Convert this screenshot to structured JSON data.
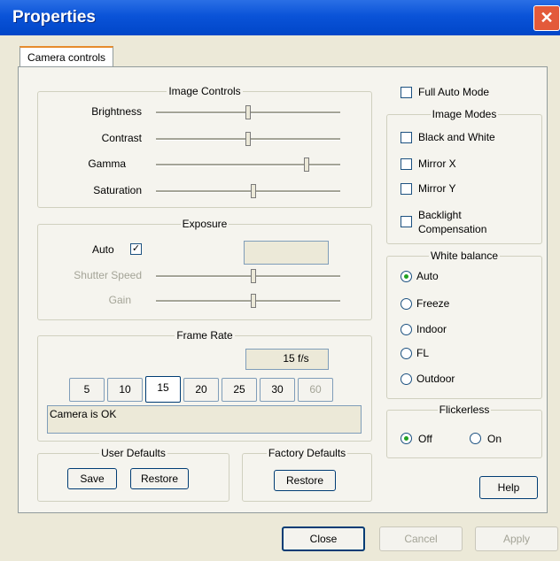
{
  "window": {
    "title": "Properties"
  },
  "tabs": [
    {
      "label": "Camera controls"
    }
  ],
  "image_controls": {
    "legend": "Image Controls",
    "sliders": [
      {
        "label": "Brightness",
        "value": 0.5
      },
      {
        "label": "Contrast",
        "value": 0.5
      },
      {
        "label": "Gamma",
        "value": 0.82
      },
      {
        "label": "Saturation",
        "value": 0.52
      }
    ]
  },
  "exposure": {
    "legend": "Exposure",
    "auto_label": "Auto",
    "auto_checked": true,
    "shutter_label": "Shutter Speed",
    "shutter_value": 0.5,
    "gain_label": "Gain",
    "gain_value": 0.5
  },
  "frame_rate": {
    "legend": "Frame Rate",
    "display": "15 f/s",
    "rates": [
      "5",
      "10",
      "15",
      "20",
      "25",
      "30",
      "60"
    ],
    "selected": "15",
    "status": "Camera is OK"
  },
  "user_defaults": {
    "legend": "User Defaults",
    "save": "Save",
    "restore": "Restore"
  },
  "factory_defaults": {
    "legend": "Factory Defaults",
    "restore": "Restore"
  },
  "full_auto": {
    "label": "Full Auto Mode",
    "checked": false
  },
  "image_modes": {
    "legend": "Image Modes",
    "items": [
      "Black and White",
      "Mirror X",
      "Mirror Y",
      "Backlight",
      "Compensation"
    ]
  },
  "white_balance": {
    "legend": "White balance",
    "options": [
      "Auto",
      "Freeze",
      "Indoor",
      "FL",
      "Outdoor"
    ],
    "selected": "Auto"
  },
  "flickerless": {
    "legend": "Flickerless",
    "off": "Off",
    "on": "On",
    "selected": "Off"
  },
  "buttons": {
    "help": "Help",
    "close": "Close",
    "cancel": "Cancel",
    "apply": "Apply"
  }
}
